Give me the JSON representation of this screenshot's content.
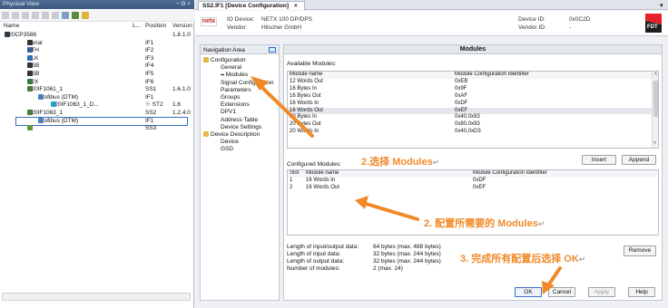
{
  "left": {
    "title": "Physical View",
    "title_controls": "− Θ ×",
    "col_name": "Name",
    "col_l": "L...",
    "col_pos": "Position",
    "col_ver": "Version",
    "rows": [
      {
        "name": "X20CP3586",
        "pos": "",
        "ver": "1.8.1.0",
        "ind": 5,
        "icon": "cpu-icon",
        "col": "#2f3a44"
      },
      {
        "name": "Serial",
        "pos": "IF1",
        "ver": "",
        "ind": 30,
        "icon": "serial-icon",
        "col": "#333"
      },
      {
        "name": "ETH",
        "pos": "IF2",
        "ver": "",
        "ind": 30,
        "icon": "eth-icon",
        "col": "#3a5a9a"
      },
      {
        "name": "PLK",
        "pos": "IF3",
        "ver": "",
        "ind": 30,
        "icon": "plk-icon",
        "col": "#2c6fb8"
      },
      {
        "name": "USB",
        "pos": "IF4",
        "ver": "",
        "ind": 30,
        "icon": "usb-icon",
        "col": "#333"
      },
      {
        "name": "USB",
        "pos": "IF5",
        "ver": "",
        "ind": 30,
        "icon": "usb-icon",
        "col": "#333"
      },
      {
        "name": "X2X",
        "pos": "IF6",
        "ver": "",
        "ind": 30,
        "icon": "x2x-icon",
        "col": "#3a7a3a"
      },
      {
        "name": "X20IF1061_1",
        "pos": "SS1",
        "ver": "1.6.1.0",
        "ind": 30,
        "icon": "module-icon",
        "col": "#4a7a3a"
      },
      {
        "name": "Profibus (DTM)",
        "pos": "IF1",
        "ver": "",
        "ind": 42,
        "icon": "profibus-icon",
        "col": "#4a80c0"
      },
      {
        "name": "X20IF1063_1_D...",
        "pos": "☉ ST2",
        "ver": "1.6",
        "ind": 56,
        "icon": "device-icon",
        "col": "#2ea0c8"
      },
      {
        "name": "X20IF1063_1",
        "pos": "SS2",
        "ver": "1.2.4.0",
        "ind": 30,
        "icon": "module-icon",
        "col": "#4a7a3a"
      },
      {
        "name": "Profibus (DTM)",
        "pos": "IF1",
        "ver": "",
        "ind": 42,
        "icon": "profibus-icon",
        "col": "#4a80c0",
        "selected": true
      },
      {
        "name": "",
        "pos": "SS3",
        "ver": "",
        "ind": 30,
        "icon": "slot-icon",
        "col": "#5a9a3a"
      }
    ]
  },
  "tab_label": "SS2.IF1 [Device Configuration]",
  "tab_close": "×",
  "header": {
    "logo": "netx",
    "io_device_label": "IO Device:",
    "io_device_value": "NETX 100 DP/DPS",
    "vendor_label": "Vendor:",
    "vendor_value": "Hilscher GmbH",
    "device_id_label": "Device ID:",
    "device_id_value": "0x0C2D",
    "vendor_id_label": "Vendor ID:",
    "vendor_id_value": "-",
    "brand": "FDT"
  },
  "nav": {
    "title": "Navigation Area",
    "items": [
      {
        "label": "Configuration",
        "ind": 3,
        "folder": true
      },
      {
        "label": "General",
        "ind": 22
      },
      {
        "label": "Modules",
        "ind": 22,
        "arrow": true
      },
      {
        "label": "Signal Configuration",
        "ind": 22
      },
      {
        "label": "Parameters",
        "ind": 22
      },
      {
        "label": "Groups",
        "ind": 22
      },
      {
        "label": "Extensions",
        "ind": 22
      },
      {
        "label": "DPV1",
        "ind": 22
      },
      {
        "label": "Address Table",
        "ind": 22
      },
      {
        "label": "Device Settings",
        "ind": 22
      },
      {
        "label": "Device Description",
        "ind": 3,
        "folder": true
      },
      {
        "label": "Device",
        "ind": 22
      },
      {
        "label": "GSD",
        "ind": 22
      }
    ]
  },
  "main": {
    "title": "Modules",
    "available_label": "Available Modules:",
    "avail_headers": [
      "Module name",
      "Module Configuration Identifier"
    ],
    "avail_rows": [
      [
        "12 Words Out",
        "0xEB"
      ],
      [
        "16 Bytes In",
        "0x9F"
      ],
      [
        "16 Bytes Out",
        "0xAF"
      ],
      [
        "16 Words In",
        "0xDF"
      ],
      [
        "16 Words Out",
        "0xEF"
      ],
      [
        "20 Bytes In",
        "0x40,0x93"
      ],
      [
        "20 Bytes Out",
        "0x80,0x93"
      ],
      [
        "20 Words In",
        "0x40,0xD3"
      ]
    ],
    "avail_selected": 4,
    "configured_label": "Configured Modules:",
    "insert": "Insert",
    "append": "Append",
    "conf_headers": [
      "Slot",
      "Module name",
      "Module Configuration Identifier"
    ],
    "conf_rows": [
      [
        "1",
        "16 Words In",
        "0xDF"
      ],
      [
        "2",
        "16 Words Out",
        "0xEF"
      ]
    ],
    "stats": [
      [
        "Length of input/output data:",
        "64 bytes (max. 488 bytes)"
      ],
      [
        "Length of input data:",
        "32 bytes (max. 244 bytes)"
      ],
      [
        "Length of output data:",
        "32 bytes (max. 244 bytes)"
      ],
      [
        "Number of modules:",
        "2 (max. 24)"
      ]
    ],
    "remove": "Remove"
  },
  "buttons": {
    "ok": "OK",
    "cancel": "Cancel",
    "apply": "Apply",
    "help": "Help"
  },
  "annotations": {
    "a1": "2.选择 Modules",
    "a2": "2. 配置所需要的 Modules",
    "a3": "3. 完成所有配置后选择 OK",
    "return_mark": "↵"
  },
  "accent": "#f08a28"
}
